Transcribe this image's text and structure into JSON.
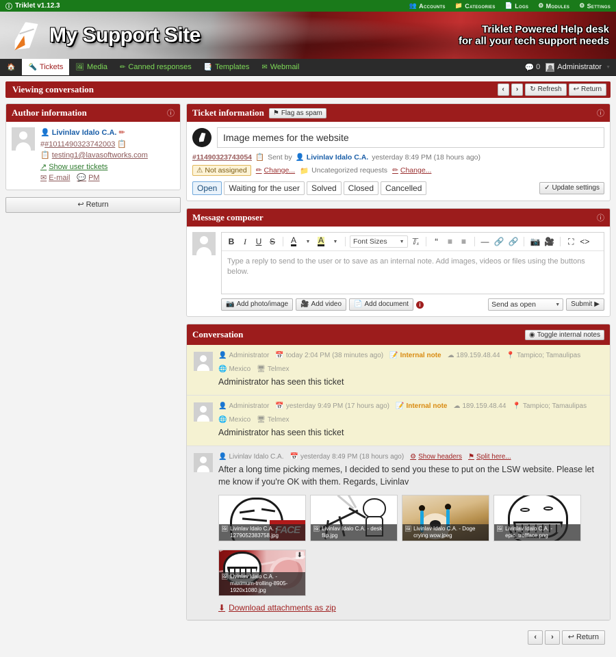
{
  "topbar": {
    "app_version": "Triklet v1.12.3",
    "info_icon": "info-icon",
    "nav": [
      {
        "label": "Accounts",
        "icon": "users-icon"
      },
      {
        "label": "Categories",
        "icon": "folder-icon"
      },
      {
        "label": "Logs",
        "icon": "file-icon"
      },
      {
        "label": "Modules",
        "icon": "plug-icon"
      },
      {
        "label": "Settings",
        "icon": "gear-icon"
      }
    ]
  },
  "banner": {
    "site_title": "My Support Site",
    "slogan_line1": "Triklet Powered Help desk",
    "slogan_line2": "for all your tech support needs"
  },
  "tabbar": {
    "home_icon": "home-icon",
    "tabs": [
      {
        "label": "Tickets",
        "icon": "ticket-icon",
        "active": true
      },
      {
        "label": "Media",
        "icon": "image-icon",
        "active": false
      },
      {
        "label": "Canned responses",
        "icon": "pencil-icon",
        "active": false
      },
      {
        "label": "Templates",
        "icon": "template-icon",
        "active": false
      },
      {
        "label": "Webmail",
        "icon": "envelope-icon",
        "active": false
      }
    ],
    "chat_count": "0",
    "account_name": "Administrator"
  },
  "pagebar": {
    "title": "Viewing conversation",
    "prev": "‹",
    "next": "›",
    "refresh": "Refresh",
    "return": "Return"
  },
  "author_panel": {
    "title": "Author information",
    "name": "Livinlav Idalo C.A.",
    "user_id": "#1011490323742003",
    "email": "testing1@lavasoftworks.com",
    "show_tickets": "Show user tickets",
    "email_action": "E-mail",
    "pm_action": "PM",
    "return_button": "Return"
  },
  "ticket_panel": {
    "title": "Ticket information",
    "flag_as_spam": "Flag as spam",
    "subject": "Image memes for the website",
    "ticket_id": "#11490323743054",
    "sent_by_label": "Sent by",
    "sent_by_user": "Livinlav Idalo C.A.",
    "sent_time": "yesterday 8:49 PM (18 hours ago)",
    "assignment": "Not assigned",
    "assignment_change": "Change...",
    "category": "Uncategorized requests",
    "category_change": "Change...",
    "statuses": [
      {
        "label": "Open",
        "active": true
      },
      {
        "label": "Waiting for the user",
        "active": false
      },
      {
        "label": "Solved",
        "active": false
      },
      {
        "label": "Closed",
        "active": false
      },
      {
        "label": "Cancelled",
        "active": false
      }
    ],
    "update_settings": "Update settings"
  },
  "composer": {
    "title": "Message composer",
    "toolbar": {
      "bold": "B",
      "italic": "I",
      "underline": "U",
      "strike": "S",
      "text_color": "A",
      "highlight_color": "A",
      "font_sizes": "Font Sizes",
      "clear_format": "Tx",
      "quote": "“",
      "indent": "indent-icon",
      "outdent": "outdent-icon",
      "horizontal_rule": "—",
      "link": "link-icon",
      "unlink": "unlink-icon",
      "image": "camera-icon",
      "video": "video-icon",
      "fullscreen": "fullscreen-icon",
      "source_code": "<>"
    },
    "placeholder": "Type a reply to send to the user or to save as an internal note. Add images, videos or files using the buttons below.",
    "add_photo": "Add photo/image",
    "add_video": "Add video",
    "add_document": "Add document",
    "info_icon": "info-icon",
    "send_mode": "Send as open",
    "submit": "Submit"
  },
  "conversation": {
    "title": "Conversation",
    "toggle_internal_notes": "Toggle internal notes",
    "messages": [
      {
        "author": "Administrator",
        "time": "today 2:04 PM (38 minutes ago)",
        "note_tag": "Internal note",
        "ip": "189.159.48.44",
        "location": "Tampico; Tamaulipas",
        "country": "Mexico",
        "isp": "Telmex",
        "text": "Administrator has seen this ticket",
        "type": "note"
      },
      {
        "author": "Administrator",
        "time": "yesterday 9:49 PM (17 hours ago)",
        "note_tag": "Internal note",
        "ip": "189.159.48.44",
        "location": "Tampico; Tamaulipas",
        "country": "Mexico",
        "isp": "Telmex",
        "text": "Administrator has seen this ticket",
        "type": "note"
      },
      {
        "author": "Livinlav Idalo C.A.",
        "time": "yesterday 8:49 PM (18 hours ago)",
        "show_headers": "Show headers",
        "split_here": "Split here...",
        "text": "After a long time picking memes, I decided to send you these to put on the LSW website. Please let me know if you're OK with them. Regards, Livinlav",
        "type": "user"
      }
    ],
    "attachments": [
      {
        "caption": "Livinlav Idalo C.A. - 1279052383758.jpg"
      },
      {
        "caption": "Livinlav Idalo C.A. - desk flip.jpg"
      },
      {
        "caption": "Livinlav Idalo C.A. - Doge crying wow.jpeg"
      },
      {
        "caption": "Livinlav Idalo C.A. - epic_trollface.png"
      },
      {
        "caption": "Livinlav Idalo C.A. - maximum-trolling-8905-1920x1080.jpg"
      }
    ],
    "download_zip": "Download attachments as zip"
  },
  "bottom_pager": {
    "prev": "‹",
    "next": "›",
    "return": "Return"
  },
  "colors": {
    "top_green": "#1a7a1a",
    "panel_red": "#9c1c1c",
    "tab_green_text": "#7dd957",
    "note_bg": "#f5f2d2",
    "user_msg_bg": "#ebebeb",
    "link_red": "#a02222"
  }
}
